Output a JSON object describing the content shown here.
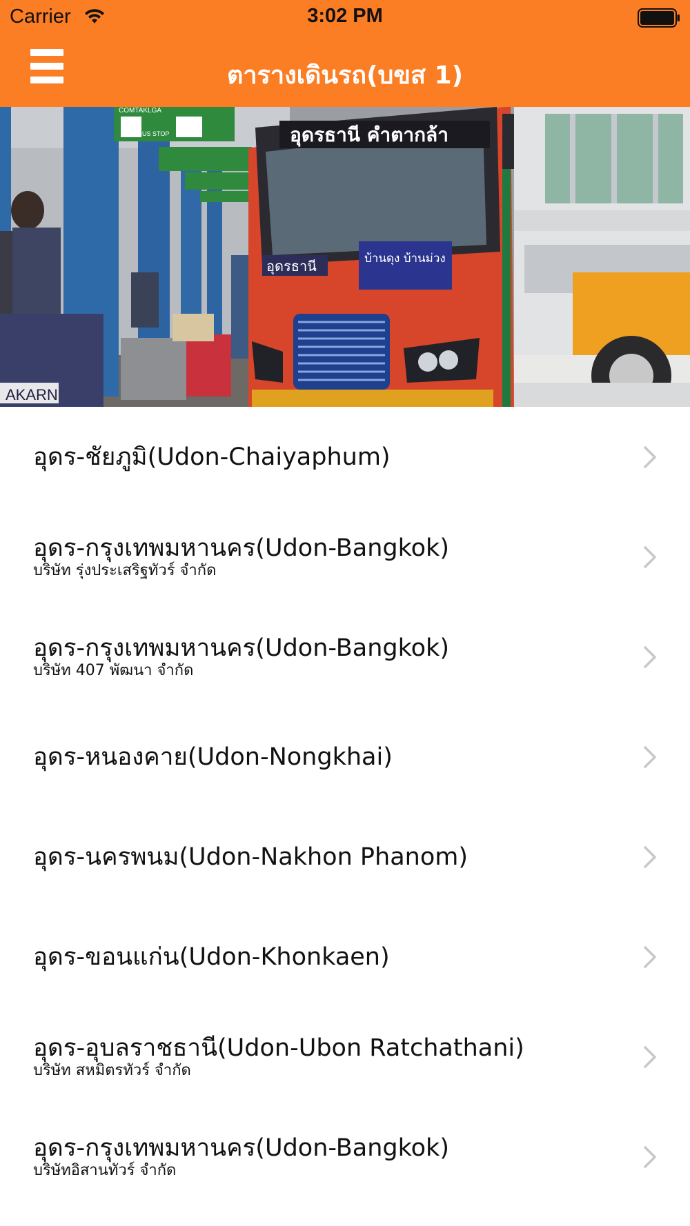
{
  "status_bar": {
    "carrier": "Carrier",
    "time": "3:02 PM",
    "icons": [
      "wifi-icon",
      "battery-icon"
    ]
  },
  "nav_bar": {
    "title": "ตารางเดินรถ(บขส 1)",
    "menu_icon": "hamburger-menu-icon",
    "background_color": "#fb7d24"
  },
  "hero": {
    "image": "bus-station-photo",
    "signs": {
      "bus_destination": "อุดรธานี คำตากล้า",
      "bus_stop_sign": "BUS STOP",
      "station_sign": "COMTAKLGA",
      "bus_side_sign": "อุดรธานี",
      "bus_route_sign": "บ้านดุง บ้านม่วง",
      "banner_text": "AKARN"
    }
  },
  "routes": [
    {
      "name": "อุดร-ชัยภูมิ(Udon-Chaiyaphum)",
      "company": ""
    },
    {
      "name": "อุดร-กรุงเทพมหานคร(Udon-Bangkok)",
      "company": "บริษัท รุ่งประเสริฐทัวร์ จำกัด"
    },
    {
      "name": "อุดร-กรุงเทพมหานคร(Udon-Bangkok)",
      "company": "บริษัท 407 พัฒนา จำกัด"
    },
    {
      "name": "อุดร-หนองคาย(Udon-Nongkhai)",
      "company": ""
    },
    {
      "name": "อุดร-นครพนม(Udon-Nakhon Phanom)",
      "company": ""
    },
    {
      "name": "อุดร-ขอนแก่น(Udon-Khonkaen)",
      "company": ""
    },
    {
      "name": "อุดร-อุบลราชธานี(Udon-Ubon Ratchathani)",
      "company": "บริษัท สหมิตรทัวร์ จำกัด"
    },
    {
      "name": "อุดร-กรุงเทพมหานคร(Udon-Bangkok)",
      "company": "บริษัทอิสานทัวร์ จำกัด"
    }
  ]
}
